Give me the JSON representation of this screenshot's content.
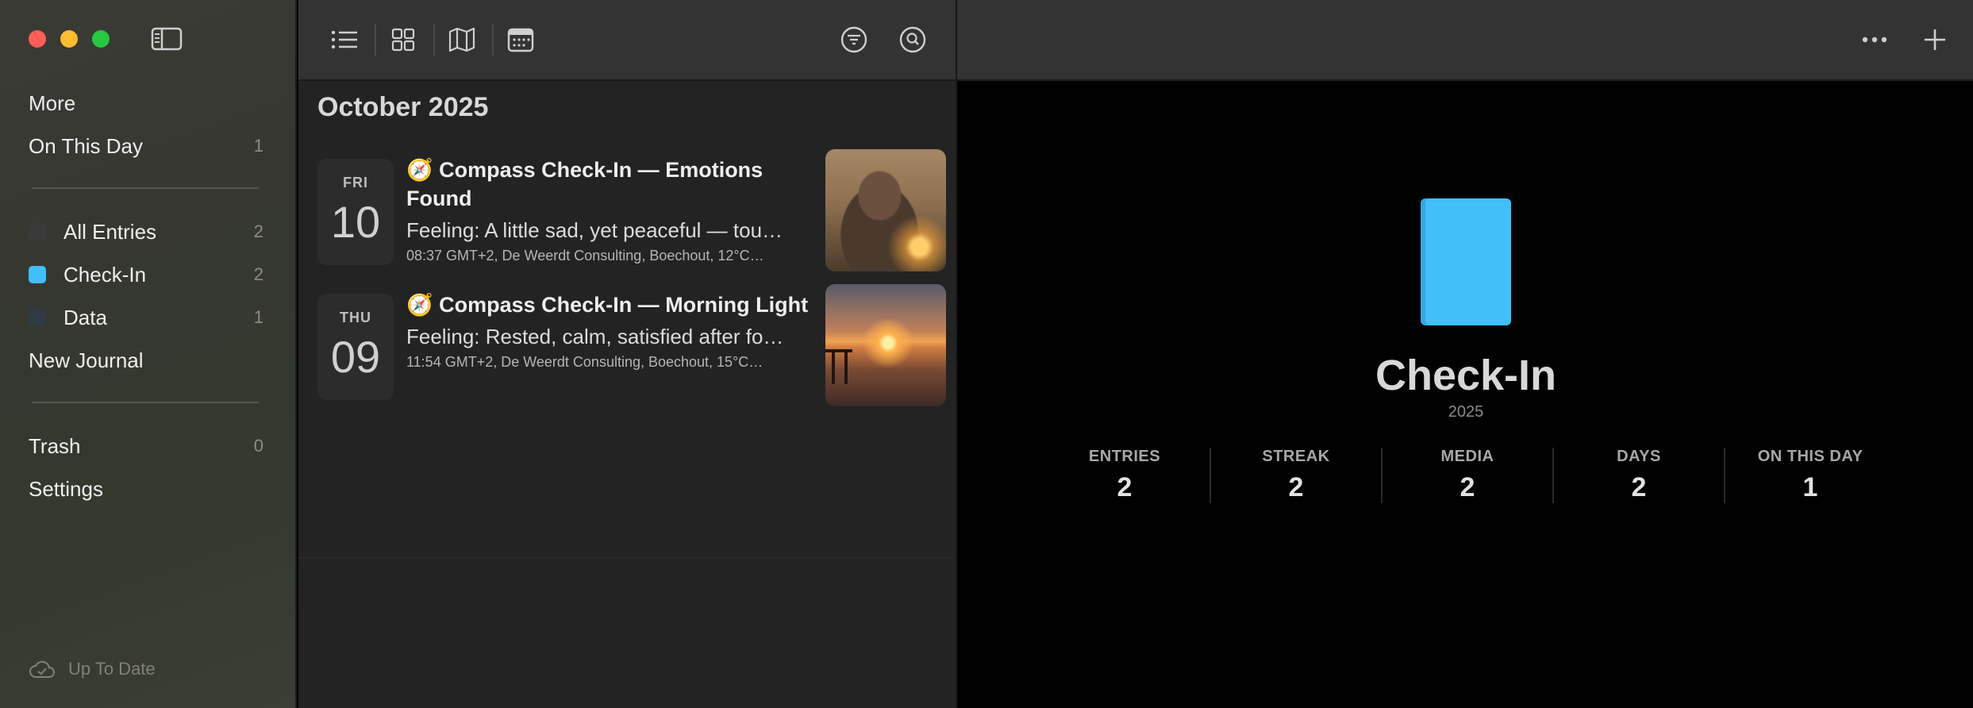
{
  "sidebar": {
    "items_top": [
      {
        "label": "More",
        "count": ""
      },
      {
        "label": "On This Day",
        "count": "1"
      }
    ],
    "journals": [
      {
        "label": "All Entries",
        "count": "2",
        "color": "#3a3a3a"
      },
      {
        "label": "Check-In",
        "count": "2",
        "color": "#40bff9"
      },
      {
        "label": "Data",
        "count": "1",
        "color": "#2f3a44"
      }
    ],
    "new_journal": "New Journal",
    "items_bottom": [
      {
        "label": "Trash",
        "count": "0"
      },
      {
        "label": "Settings",
        "count": ""
      }
    ],
    "sync_status": "Up To Date"
  },
  "list": {
    "month_header": "October 2025",
    "entries": [
      {
        "dow": "FRI",
        "day": "10",
        "title": "🧭 Compass Check-In — Emotions Found",
        "snippet": "Feeling: A little sad, yet peaceful — tou…",
        "meta": "08:37 GMT+2,  De Weerdt Consulting, Boechout,  12°C…"
      },
      {
        "dow": "THU",
        "day": "09",
        "title": "🧭 Compass Check-In — Morning Light",
        "snippet": "Feeling: Rested, calm, satisfied after fo…",
        "meta": "11:54 GMT+2,  De Weerdt Consulting, Boechout,  15°C…"
      }
    ]
  },
  "detail": {
    "journal_name": "Check-In",
    "year": "2025",
    "cover_color": "#40bff9",
    "stats": [
      {
        "label": "ENTRIES",
        "value": "2"
      },
      {
        "label": "STREAK",
        "value": "2"
      },
      {
        "label": "MEDIA",
        "value": "2"
      },
      {
        "label": "DAYS",
        "value": "2"
      },
      {
        "label": "ON THIS DAY",
        "value": "1"
      }
    ]
  },
  "icons": {
    "toolbar": [
      "list-view-icon",
      "grid-view-icon",
      "map-view-icon",
      "calendar-view-icon",
      "filter-icon",
      "search-icon"
    ],
    "detail_toolbar": [
      "more-options-icon",
      "add-entry-icon"
    ]
  }
}
